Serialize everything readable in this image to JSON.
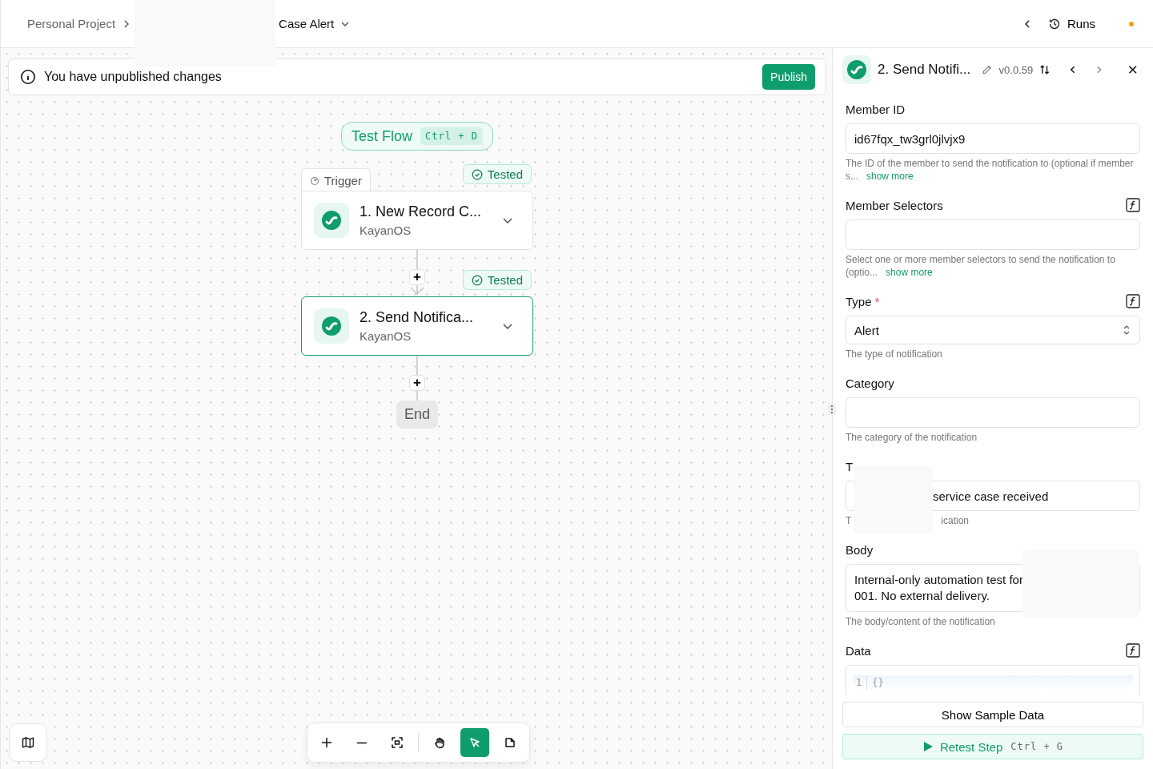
{
  "breadcrumb": {
    "project": "Personal Project",
    "flow": "Case Alert"
  },
  "top_bar": {
    "runs": "Runs"
  },
  "banner": {
    "message": "You have unpublished changes",
    "publish": "Publish"
  },
  "canvas": {
    "test_flow": {
      "label": "Test Flow",
      "shortcut": "Ctrl + D"
    },
    "steps": [
      {
        "kind": "trigger",
        "tab": "Trigger",
        "badge": "Tested",
        "title": "1. New Record C...",
        "app": "KayanOS",
        "selected": false
      },
      {
        "kind": "action",
        "badge": "Tested",
        "title": "2. Send Notifica...",
        "app": "KayanOS",
        "selected": true
      }
    ],
    "add_buttons": [
      "+",
      "+"
    ],
    "end": "End",
    "tools": [
      {
        "kind": "zoom-in",
        "selected": false
      },
      {
        "kind": "zoom-out",
        "selected": false
      },
      {
        "kind": "fit",
        "selected": false
      },
      {
        "kind": "divider"
      },
      {
        "kind": "hand",
        "selected": false
      },
      {
        "kind": "pointer",
        "selected": true
      },
      {
        "kind": "note",
        "selected": false
      }
    ]
  },
  "panel": {
    "title": "2. Send Notifi...",
    "version": "v0.0.59",
    "fields": [
      {
        "kind": "text",
        "label": "Member ID",
        "formula": false,
        "value": "id67fqx_tw3grl0jlvjx9",
        "help": "The ID of the member to send the notification to (optional if member s...",
        "show_more": "show more"
      },
      {
        "kind": "text",
        "label": "Member Selectors",
        "formula": true,
        "help": "Select one or more member selectors to send the notification to (optio...",
        "show_more": "show more"
      },
      {
        "kind": "select",
        "label": "Type",
        "required_mark": "*",
        "formula": true,
        "value": "Alert",
        "help": "The type of notification"
      },
      {
        "kind": "text",
        "label": "Category",
        "formula": false,
        "help": "The category of the notification"
      },
      {
        "kind": "obscured",
        "label": "T",
        "formula": false,
        "value": "service case received",
        "help_fragments": [
          "T",
          "ication"
        ]
      },
      {
        "kind": "textarea",
        "label": "Body",
        "formula": false,
        "value_lines": [
          "Internal-only automation test for",
          "001. No external delivery."
        ],
        "help": "The body/content of the notification"
      },
      {
        "kind": "code",
        "label": "Data",
        "formula": true,
        "line_number": "1",
        "code": "{}"
      }
    ],
    "show_sample": "Show Sample Data",
    "retest": {
      "label": "Retest Step",
      "shortcut": "Ctrl + G"
    }
  }
}
